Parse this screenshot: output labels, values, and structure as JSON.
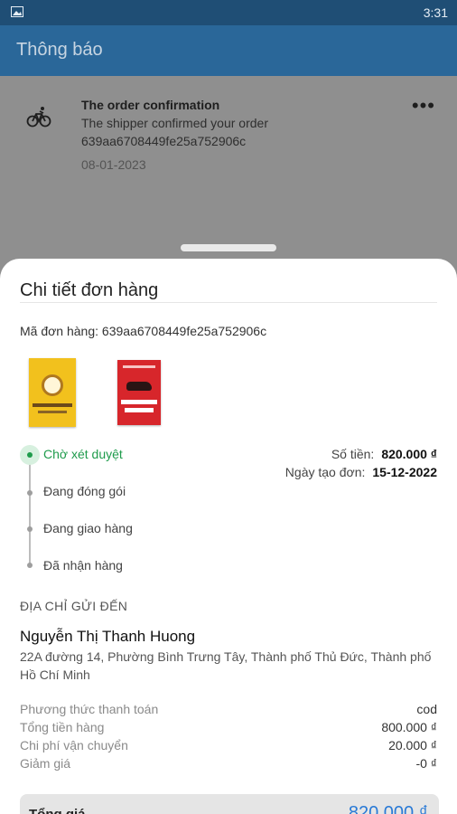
{
  "status_bar": {
    "time": "3:31",
    "image_icon": "image-icon"
  },
  "app_bar": {
    "title": "Thông báo"
  },
  "notification": {
    "icon": "bicycle-icon",
    "title": "The order confirmation",
    "message": "The shipper confirmed your order",
    "order_id": "639aa6708449fe25a752906c",
    "date": "08-01-2023",
    "more_icon": "more-horizontal-icon",
    "more_label": "•••"
  },
  "sheet": {
    "title": "Chi tiết đơn hàng",
    "order_id_label": "Mã đơn hàng: 639aa6708449fe25a752906c",
    "books": [
      "book-cover-yellow",
      "book-cover-red"
    ],
    "steps": [
      "Chờ xét duyệt",
      "Đang đóng gói",
      "Đang giao hàng",
      "Đã nhận hàng"
    ],
    "active_step_index": 0,
    "amount_label": "Số tiền:",
    "amount_value": "820.000 ₫",
    "created_label": "Ngày tạo đơn:",
    "created_value": "15-12-2022",
    "section_address": "ĐỊA CHỈ GỬI ĐẾN",
    "recipient": "Nguyễn Thị Thanh Huong",
    "address": "22A đường 14, Phường Bình Trưng Tây, Thành phố Thủ Đức, Thành phố Hồ Chí Minh",
    "payment_rows": [
      {
        "label": "Phương thức thanh toán",
        "value": "cod"
      },
      {
        "label": "Tổng tiền hàng",
        "value": "800.000 ₫"
      },
      {
        "label": "Chi phí vận chuyển",
        "value": "20.000 ₫"
      },
      {
        "label": "Giảm giá",
        "value": "-0 ₫"
      }
    ],
    "total_label": "Tổng giá",
    "total_value": "820.000 ₫"
  },
  "colors": {
    "app_bar": "#2a6799",
    "status_bar": "#1f4e75",
    "active_step": "#1f9b4c",
    "total_value": "#2a7ad6"
  }
}
